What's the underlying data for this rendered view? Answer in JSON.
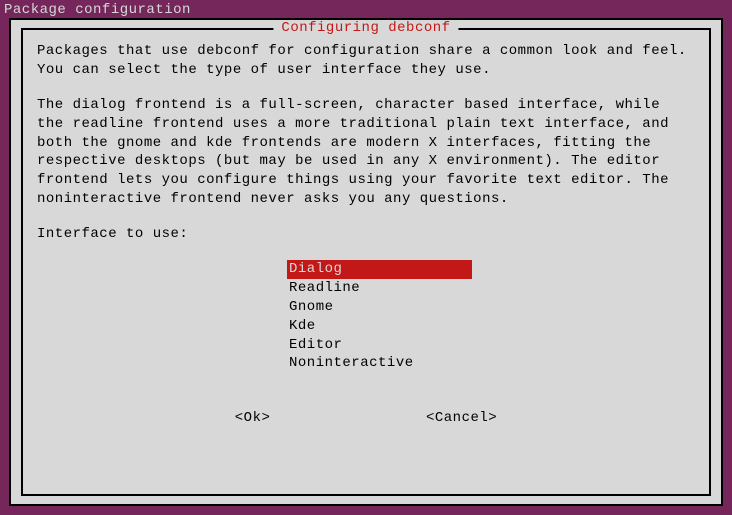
{
  "outer_title": "Package configuration",
  "dialog": {
    "title": "Configuring debconf",
    "description1": "Packages that use debconf for configuration share a common look and feel. You can select the type of user interface they use.",
    "description2": "The dialog frontend is a full-screen, character based interface, while the readline frontend uses a more traditional plain text interface, and both the gnome and kde frontends are modern X interfaces, fitting the respective desktops (but may be used in any X environment). The editor frontend lets you configure things using your favorite text editor. The noninteractive frontend never asks you any questions.",
    "prompt": "Interface to use:",
    "options": [
      {
        "label": "Dialog",
        "selected": true
      },
      {
        "label": "Readline",
        "selected": false
      },
      {
        "label": "Gnome",
        "selected": false
      },
      {
        "label": "Kde",
        "selected": false
      },
      {
        "label": "Editor",
        "selected": false
      },
      {
        "label": "Noninteractive",
        "selected": false
      }
    ],
    "buttons": {
      "ok": "<Ok>",
      "cancel": "<Cancel>"
    }
  },
  "colors": {
    "background": "#75265b",
    "dialog_bg": "#d8d8d8",
    "border": "#000000",
    "title_fg": "#c31818",
    "selected_bg": "#c31818",
    "selected_fg": "#d8d8d8",
    "text": "#000000",
    "outer_title_fg": "#d8d8d8"
  }
}
